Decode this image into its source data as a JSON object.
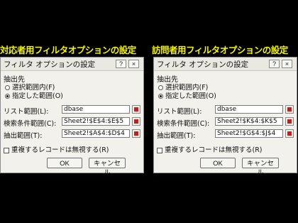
{
  "left": {
    "heading": "対応者用フィルタオプションの設定",
    "dialog": {
      "title": "フィルタ オプションの設定",
      "help_label": "?",
      "close_label": "×",
      "group_label": "抽出先",
      "radio_selected_range": "選択範囲内(F)",
      "radio_specified_range": "指定した範囲(O)",
      "list_range_label": "リスト範囲(L):",
      "list_range_value": "dbase",
      "criteria_range_label": "検索条件範囲(C):",
      "criteria_range_value": "Sheet2!$E$4:$E$5",
      "extract_range_label": "抽出範囲(T):",
      "extract_range_value": "Sheet2!$A$4:$D$4",
      "unique_records_label": "重複するレコードは無視する(R)",
      "ok_label": "OK",
      "cancel_label": "キャンセル"
    }
  },
  "right": {
    "heading": "訪問者用フィルタオプションの設定",
    "dialog": {
      "title": "フィルタ オプションの設定",
      "help_label": "?",
      "close_label": "×",
      "group_label": "抽出先",
      "radio_selected_range": "選択範囲内(F)",
      "radio_specified_range": "指定した範囲(O)",
      "list_range_label": "リスト範囲(L):",
      "list_range_value": "dbase",
      "criteria_range_label": "検索条件範囲(C):",
      "criteria_range_value": "Sheet2!$K$4:$K$5",
      "extract_range_label": "抽出範囲(T):",
      "extract_range_value": "Sheet2!$G$4:$J$4",
      "unique_records_label": "重複するレコードは無視する(R)",
      "ok_label": "OK",
      "cancel_label": "キャンセル"
    }
  },
  "colors": {
    "background": "#000000",
    "heading_text": "#f4f400",
    "dialog_face": "#f2f1eb",
    "range_button_mark": "#c0201c"
  }
}
